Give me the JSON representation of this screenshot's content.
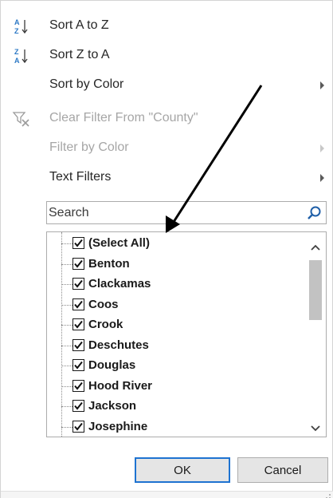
{
  "menu": {
    "sort_az": "Sort A to Z",
    "sort_za": "Sort Z to A",
    "sort_by_color": "Sort by Color",
    "clear_filter": "Clear Filter From \"County\"",
    "filter_by_color": "Filter by Color",
    "text_filters": "Text Filters"
  },
  "search": {
    "placeholder": "Search"
  },
  "list": {
    "items": [
      "(Select All)",
      "Benton",
      "Clackamas",
      "Coos",
      "Crook",
      "Deschutes",
      "Douglas",
      "Hood River",
      "Jackson",
      "Josephine"
    ],
    "all_checked": true
  },
  "buttons": {
    "ok": "OK",
    "cancel": "Cancel"
  },
  "colors": {
    "accent": "#1e73d1",
    "disabled": "#a6a6a6",
    "sort_icon_blue": "#2b78c5"
  }
}
